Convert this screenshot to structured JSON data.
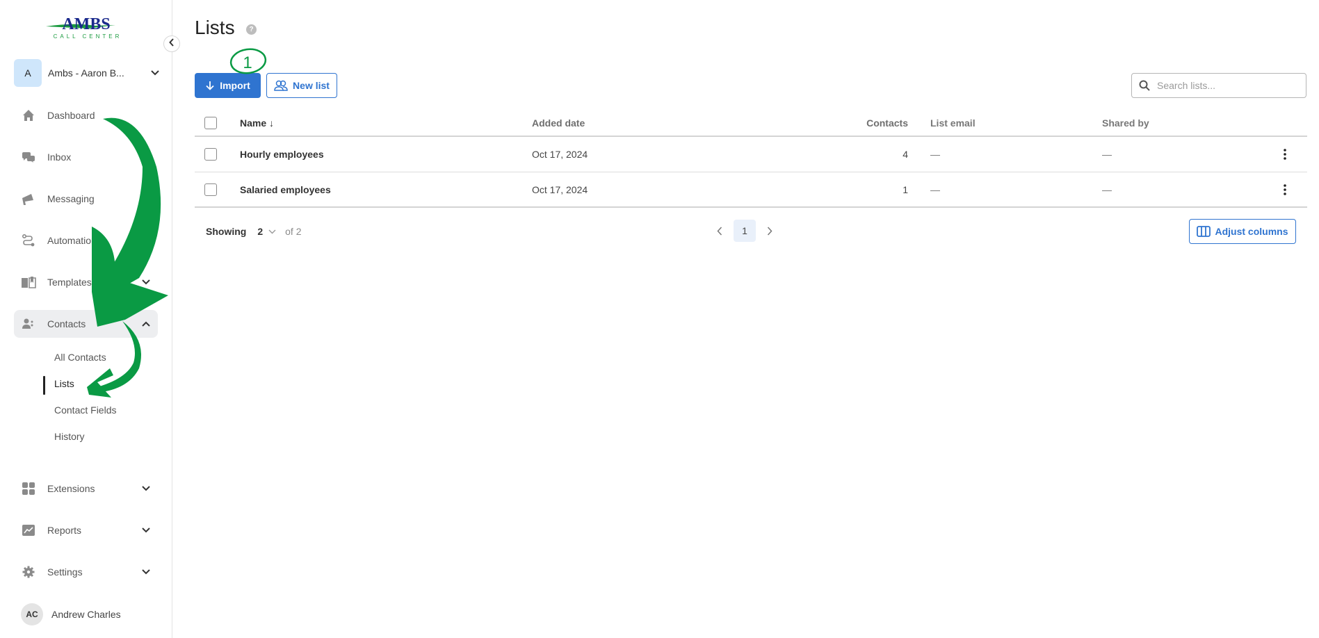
{
  "brand": {
    "logo_text": "AMBS",
    "logo_subtext": "CALL CENTER",
    "logo_colors": {
      "primary": "#1b2a8c",
      "accent": "#1a9a3f"
    }
  },
  "account": {
    "initial": "A",
    "name": "Ambs - Aaron B..."
  },
  "sidebar": {
    "items": [
      {
        "label": "Dashboard",
        "icon": "home-icon",
        "has_chevron": false
      },
      {
        "label": "Inbox",
        "icon": "chat-bubbles-icon",
        "has_chevron": false
      },
      {
        "label": "Messaging",
        "icon": "megaphone-icon",
        "has_chevron": false
      },
      {
        "label": "Automations",
        "icon": "route-icon",
        "has_chevron": false
      },
      {
        "label": "Templates",
        "icon": "book-icon",
        "has_chevron": true
      },
      {
        "label": "Contacts",
        "icon": "people-icon",
        "has_chevron": true,
        "expanded": true,
        "active": true
      },
      {
        "label": "Extensions",
        "icon": "grid-icon",
        "has_chevron": true
      },
      {
        "label": "Reports",
        "icon": "chart-icon",
        "has_chevron": true
      },
      {
        "label": "Settings",
        "icon": "gear-icon",
        "has_chevron": true
      }
    ],
    "contacts_sub": [
      {
        "label": "All Contacts"
      },
      {
        "label": "Lists",
        "active": true
      },
      {
        "label": "Contact Fields"
      },
      {
        "label": "History"
      }
    ]
  },
  "user": {
    "initials": "AC",
    "name": "Andrew Charles"
  },
  "page": {
    "title": "Lists",
    "help_glyph": "?",
    "import_label": "Import",
    "new_list_label": "New list",
    "search_placeholder": "Search lists..."
  },
  "table": {
    "columns": {
      "name": "Name",
      "name_sort": "↓",
      "added_date": "Added date",
      "contacts": "Contacts",
      "list_email": "List email",
      "shared_by": "Shared by"
    },
    "rows": [
      {
        "name": "Hourly employees",
        "added_date": "Oct 17, 2024",
        "contacts": "4",
        "list_email": "—",
        "shared_by": "—"
      },
      {
        "name": "Salaried employees",
        "added_date": "Oct 17, 2024",
        "contacts": "1",
        "list_email": "—",
        "shared_by": "—"
      }
    ]
  },
  "pagination": {
    "showing_label": "Showing",
    "page_size": "2",
    "of_label": "of 2",
    "current_page": "1",
    "adjust_columns_label": "Adjust columns"
  },
  "annotation": {
    "step_number": "1",
    "color": "#0a9a44"
  }
}
